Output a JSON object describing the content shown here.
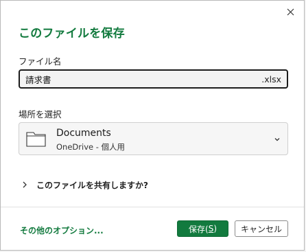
{
  "dialog": {
    "title": "このファイルを保存",
    "close_icon": "close-icon"
  },
  "filename": {
    "label": "ファイル名",
    "value": "請求書",
    "extension": ".xlsx"
  },
  "location": {
    "label": "場所を選択",
    "folder_name": "Documents",
    "folder_path": "OneDrive - 個人用",
    "icon": "folder-icon"
  },
  "share": {
    "label": "このファイルを共有しますか?"
  },
  "footer": {
    "more_options": "その他のオプション...",
    "save_label": "保存(",
    "save_accel": "S",
    "save_close": ")",
    "cancel_label": "キャンセル"
  },
  "colors": {
    "accent": "#127a3e"
  }
}
